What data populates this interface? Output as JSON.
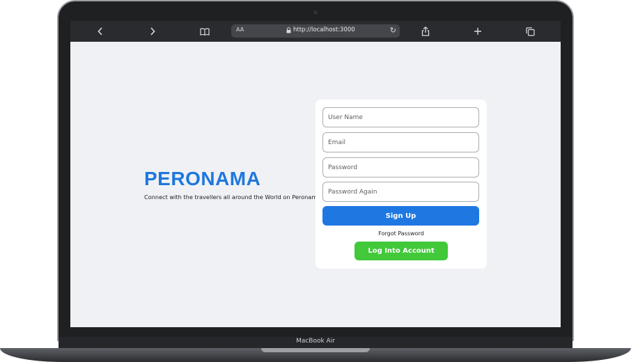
{
  "device": {
    "label": "MacBook Air"
  },
  "browser": {
    "reader_label": "AA",
    "url": "http://localhost:3000",
    "icons": [
      "chevron-left-icon",
      "chevron-right-icon",
      "book-icon",
      "lock-icon",
      "reload-icon",
      "share-icon",
      "plus-icon",
      "tabs-icon"
    ]
  },
  "hero": {
    "brand": "PERONAMA",
    "tagline": "Connect with the travellers all around the World on Peronama"
  },
  "form": {
    "username_placeholder": "User Name",
    "email_placeholder": "Email",
    "password_placeholder": "Password",
    "password_again_placeholder": "Password Again",
    "signup_label": "Sign Up",
    "forgot_label": "Forgot Password",
    "login_label": "Log Into Account"
  },
  "colors": {
    "brand": "#1f78dd",
    "signup_button": "#1f78e2",
    "login_button": "#41c93a",
    "page_background": "#f0f1f5"
  }
}
